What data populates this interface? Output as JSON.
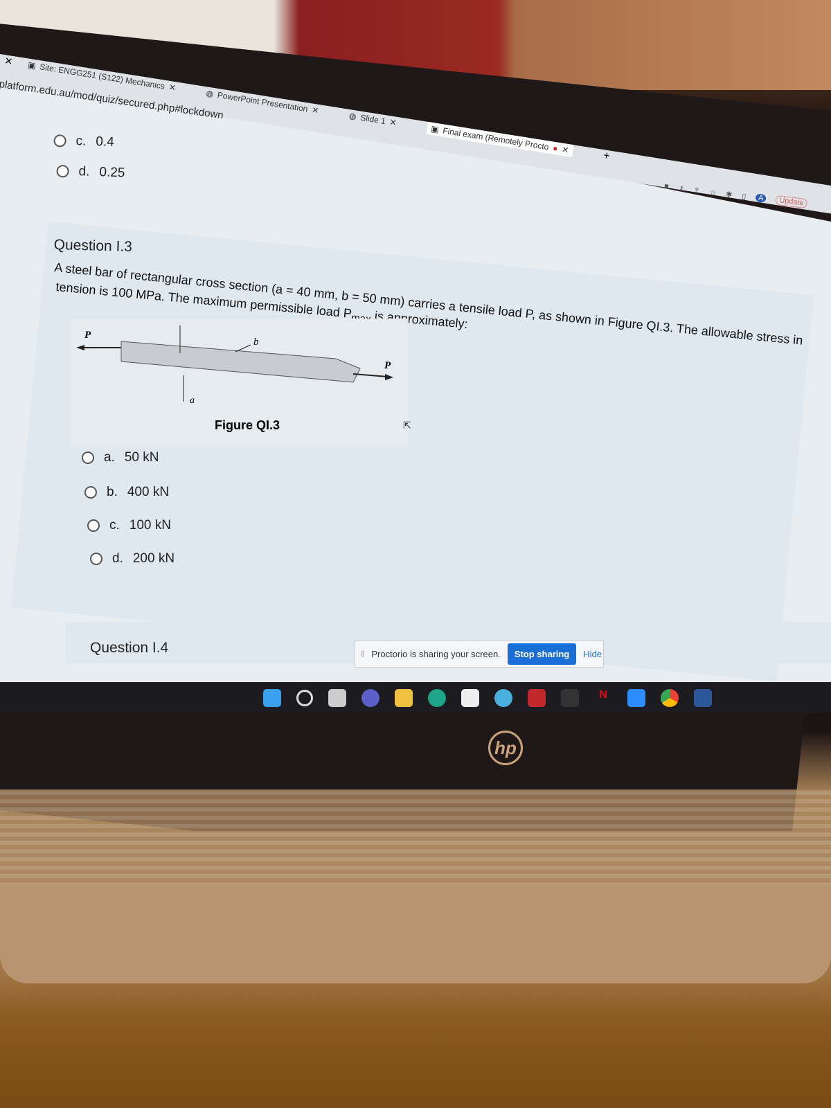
{
  "browser": {
    "tabs": [
      {
        "label": "Site: ENGG251 (S122) Mechanics",
        "icon": "moodle-icon"
      },
      {
        "label": "PowerPoint Presentation",
        "icon": "globe-icon"
      },
      {
        "label": "Slide 1",
        "icon": "globe-icon"
      },
      {
        "label": "Final exam (Remotely Procto",
        "icon": "moodle-icon",
        "active": true
      }
    ],
    "url": "platform.edu.au/mod/quiz/secured.php#lockdown",
    "update_label": "Update"
  },
  "previous_question": {
    "options": [
      {
        "letter": "c.",
        "value": "0.4"
      },
      {
        "letter": "d.",
        "value": "0.25"
      }
    ]
  },
  "question": {
    "title": "Question I.3",
    "text_1": "A steel bar of rectangular cross section (a = 40 mm, b = 50 mm) carries a tensile load P, as shown in Figure QI.3. The allowable stress in",
    "text_2": "tension is 100 MPa. The maximum permissible load P",
    "text_sub": "max",
    "text_3": " is approximately:",
    "figure": {
      "caption": "Figure QI.3",
      "label_p_left": "P",
      "label_p_right": "P",
      "label_a": "a",
      "label_b": "b"
    },
    "options": [
      {
        "letter": "a.",
        "value": "50 kN"
      },
      {
        "letter": "b.",
        "value": "400 kN"
      },
      {
        "letter": "c.",
        "value": "100 kN"
      },
      {
        "letter": "d.",
        "value": "200 kN"
      }
    ]
  },
  "next_question": {
    "title": "Question I.4"
  },
  "proctorio": {
    "message": "Proctorio is sharing your screen.",
    "stop_label": "Stop sharing",
    "hide_label": "Hide",
    "accent": "#1a6fd6"
  },
  "taskbar": {
    "icons": [
      "windows-start-icon",
      "search-icon",
      "task-view-icon",
      "teams-icon",
      "file-explorer-icon",
      "edge-icon",
      "store-icon",
      "weather-icon",
      "mcafee-icon",
      "app-icon",
      "netflix-icon",
      "zoom-icon",
      "chrome-icon",
      "word-icon"
    ]
  },
  "laptop": {
    "brand": "hp"
  }
}
